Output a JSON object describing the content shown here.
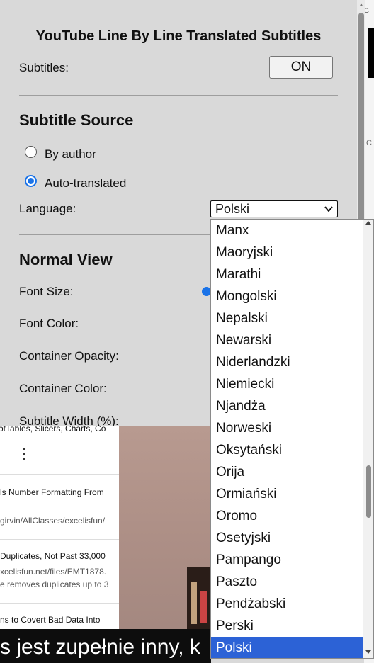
{
  "popup": {
    "title": "YouTube Line By Line Translated Subtitles",
    "subtitles_label": "Subtitles:",
    "subtitles_toggle": "ON",
    "source_title": "Subtitle Source",
    "by_author": "By author",
    "auto_translated": "Auto-translated",
    "selected_source": "auto_translated",
    "language_label": "Language:",
    "language_value": "Polski",
    "normal_view_title": "Normal View",
    "font_size_label": "Font Size:",
    "font_color_label": "Font Color:",
    "container_opacity_label": "Container Opacity:",
    "container_color_label": "Container Color:",
    "subtitle_width_label": "Subtitle Width (%):"
  },
  "language_options": [
    "Manx",
    "Maoryjski",
    "Marathi",
    "Mongolski",
    "Nepalski",
    "Newarski",
    "Niderlandzki",
    "Niemiecki",
    "Njandża",
    "Norweski",
    "Oksytański",
    "Orija",
    "Ormiański",
    "Oromo",
    "Osetyjski",
    "Pampango",
    "Paszto",
    "Pendżabski",
    "Perski",
    "Polski"
  ],
  "selected_language": "Polski",
  "video": {
    "header_fragment": "otTables, Slicers, Charts, Co",
    "items": [
      {
        "title": "ls Number Formatting From",
        "subtitle": "girvin/AllClasses/excelisfun/"
      },
      {
        "title": "Duplicates, Not Past 33,000",
        "subtitle": "xcelisfun.net/files/EMT1878.",
        "subtitle2": "e removes duplicates up to 3"
      },
      {
        "title": "ns to Covert Bad Data Into",
        "subtitle": ""
      }
    ],
    "caption": "s jest zupełnie inny, k"
  },
  "browser_strip": {
    "tiny_top": "G",
    "tiny_mid": "C"
  },
  "colors": {
    "accent": "#1a73e8",
    "selected_option": "#2c62d6",
    "popup_bg": "#d9d9d9"
  }
}
